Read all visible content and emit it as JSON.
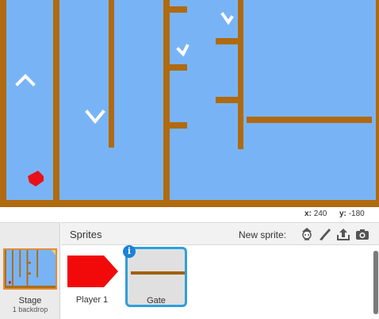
{
  "stage": {
    "background_color": "#78b4f5",
    "wall_color": "#b06a10",
    "player_color": "#e8111a",
    "arrow_color": "#ffffff"
  },
  "coords": {
    "x_label": "x:",
    "x_value": "240",
    "y_label": "y:",
    "y_value": "-180"
  },
  "stage_panel": {
    "label": "Stage",
    "backdrops": "1 backdrop"
  },
  "sprites_panel": {
    "title": "Sprites",
    "new_sprite_label": "New sprite:",
    "tools": [
      {
        "icon": "character-library-icon"
      },
      {
        "icon": "paintbrush-icon"
      },
      {
        "icon": "upload-icon"
      },
      {
        "icon": "camera-icon"
      }
    ],
    "sprites": [
      {
        "name": "Player 1",
        "selected": false
      },
      {
        "name": "Gate",
        "selected": true,
        "info_badge": "i"
      }
    ]
  }
}
